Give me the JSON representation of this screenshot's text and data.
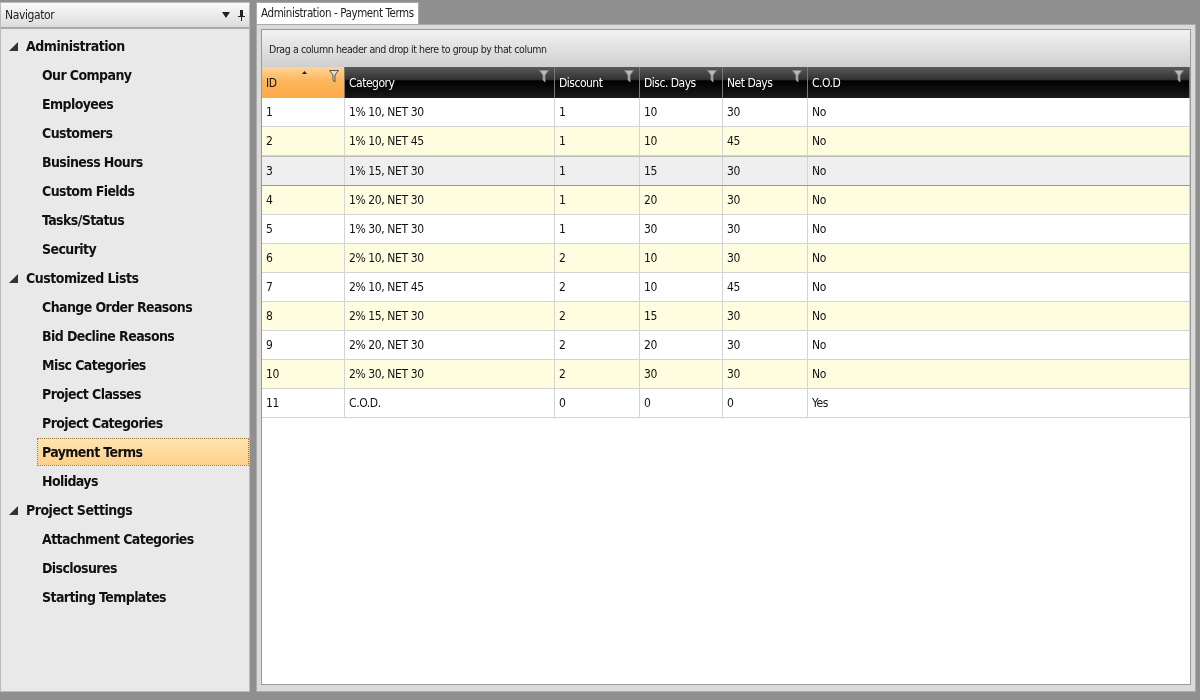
{
  "navigator": {
    "title": "Navigator",
    "groups": [
      {
        "label": "Administration",
        "expanded": true,
        "children": [
          {
            "label": "Our Company",
            "selected": false
          },
          {
            "label": "Employees",
            "selected": false
          },
          {
            "label": "Customers",
            "selected": false
          },
          {
            "label": "Business Hours",
            "selected": false
          },
          {
            "label": "Custom Fields",
            "selected": false
          },
          {
            "label": "Tasks/Status",
            "selected": false
          },
          {
            "label": "Security",
            "selected": false
          }
        ]
      },
      {
        "label": "Customized Lists",
        "expanded": true,
        "children": [
          {
            "label": "Change Order Reasons",
            "selected": false
          },
          {
            "label": "Bid Decline Reasons",
            "selected": false
          },
          {
            "label": "Misc Categories",
            "selected": false
          },
          {
            "label": "Project Classes",
            "selected": false
          },
          {
            "label": "Project Categories",
            "selected": false
          },
          {
            "label": "Payment Terms",
            "selected": true
          },
          {
            "label": "Holidays",
            "selected": false
          }
        ]
      },
      {
        "label": "Project Settings",
        "expanded": true,
        "children": [
          {
            "label": "Attachment Categories",
            "selected": false
          },
          {
            "label": "Disclosures",
            "selected": false
          },
          {
            "label": "Starting Templates",
            "selected": false
          }
        ]
      }
    ]
  },
  "tabs": [
    {
      "label": "Administration - Payment Terms",
      "selected": true
    }
  ],
  "grid": {
    "group_hint": "Drag a column header and drop it here to group by that column",
    "columns": [
      {
        "label": "ID",
        "sorted": true
      },
      {
        "label": "Category",
        "sorted": false
      },
      {
        "label": "Discount",
        "sorted": false
      },
      {
        "label": "Disc. Days",
        "sorted": false
      },
      {
        "label": "Net Days",
        "sorted": false
      },
      {
        "label": "C.O.D",
        "sorted": false
      }
    ],
    "rows": [
      {
        "cells": [
          "1",
          "1% 10, NET 30",
          "1",
          "10",
          "30",
          "No"
        ],
        "selected": false
      },
      {
        "cells": [
          "2",
          "1% 10, NET 45",
          "1",
          "10",
          "45",
          "No"
        ],
        "selected": false
      },
      {
        "cells": [
          "3",
          "1% 15, NET 30",
          "1",
          "15",
          "30",
          "No"
        ],
        "selected": true
      },
      {
        "cells": [
          "4",
          "1% 20, NET 30",
          "1",
          "20",
          "30",
          "No"
        ],
        "selected": false
      },
      {
        "cells": [
          "5",
          "1% 30, NET 30",
          "1",
          "30",
          "30",
          "No"
        ],
        "selected": false
      },
      {
        "cells": [
          "6",
          "2% 10, NET 30",
          "2",
          "10",
          "30",
          "No"
        ],
        "selected": false
      },
      {
        "cells": [
          "7",
          "2% 10, NET 45",
          "2",
          "10",
          "45",
          "No"
        ],
        "selected": false
      },
      {
        "cells": [
          "8",
          "2% 15, NET 30",
          "2",
          "15",
          "30",
          "No"
        ],
        "selected": false
      },
      {
        "cells": [
          "9",
          "2% 20, NET 30",
          "2",
          "20",
          "30",
          "No"
        ],
        "selected": false
      },
      {
        "cells": [
          "10",
          "2% 30, NET 30",
          "2",
          "30",
          "30",
          "No"
        ],
        "selected": false
      },
      {
        "cells": [
          "11",
          "C.O.D.",
          "0",
          "0",
          "0",
          "Yes"
        ],
        "selected": false
      }
    ]
  }
}
